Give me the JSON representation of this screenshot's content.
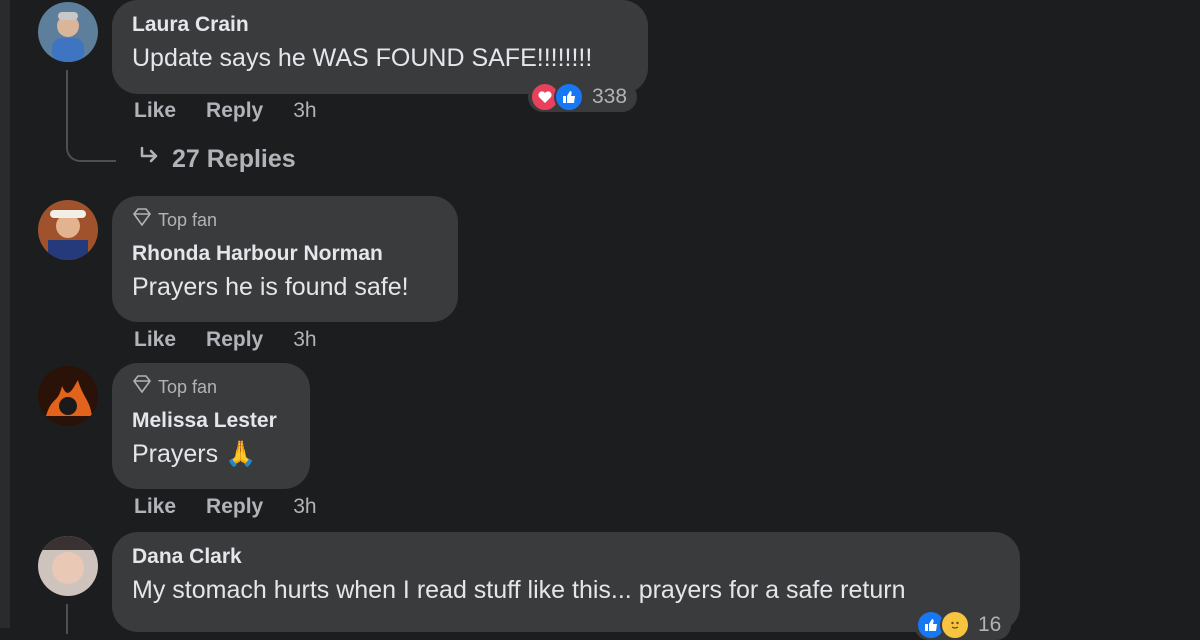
{
  "colors": {
    "background": "#1c1d1f",
    "bubble": "#3a3b3c",
    "text": "#e4e6eb",
    "muted": "#b0b3b8",
    "love": "#e8415d",
    "like": "#1877f2"
  },
  "comments": [
    {
      "author": "Laura Crain",
      "text": "Update says he WAS FOUND SAFE!!!!!!!!",
      "like": "Like",
      "reply": "Reply",
      "time": "3h",
      "reaction_count": "338",
      "replies": "27 Replies"
    },
    {
      "badge": "Top fan",
      "author": "Rhonda Harbour Norman",
      "text": "Prayers he is found safe!",
      "like": "Like",
      "reply": "Reply",
      "time": "3h"
    },
    {
      "badge": "Top fan",
      "author": "Melissa Lester",
      "text": "Prayers 🙏",
      "like": "Like",
      "reply": "Reply",
      "time": "3h"
    },
    {
      "author": "Dana Clark",
      "text": "My stomach hurts when I read stuff like this... prayers for a safe return",
      "reaction_count": "16"
    }
  ]
}
